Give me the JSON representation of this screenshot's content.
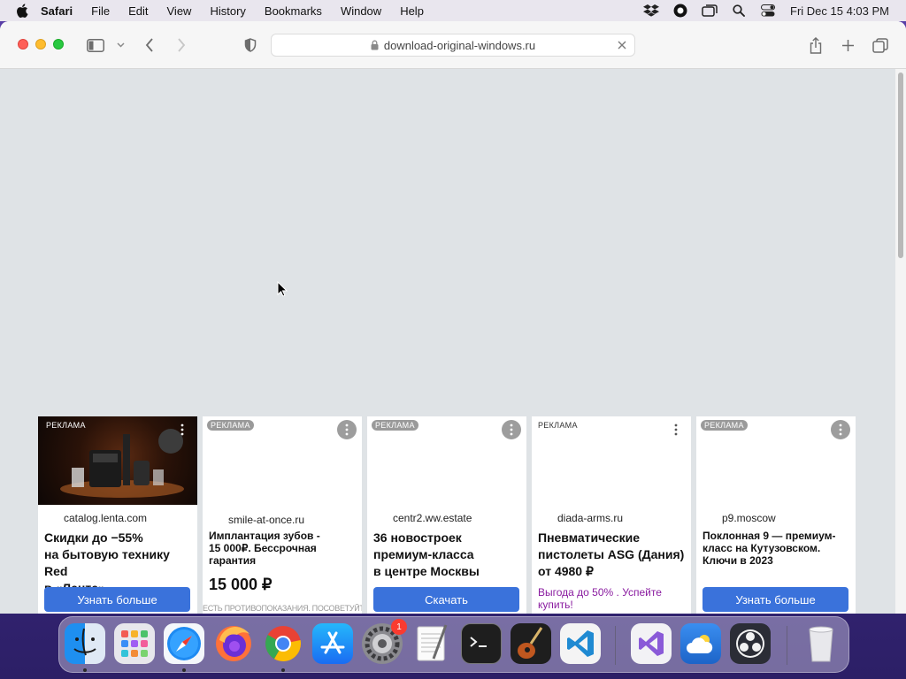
{
  "menubar": {
    "app": "Safari",
    "items": [
      "File",
      "Edit",
      "View",
      "History",
      "Bookmarks",
      "Window",
      "Help"
    ],
    "clock": "Fri Dec 15  4:03 PM",
    "status_icons": [
      "dropbox-icon",
      "record-icon",
      "screens-icon",
      "spotlight-icon",
      "control-center-icon"
    ]
  },
  "browser": {
    "url": "download-original-windows.ru"
  },
  "ads": [
    {
      "badge": "РЕКЛАМА",
      "domain": "catalog.lenta.com",
      "title_lines": [
        "Скидки до −55%",
        "на бытовую технику Red",
        "в «Ленте»"
      ],
      "cta": "Узнать больше"
    },
    {
      "badge": "РЕКЛАМА",
      "domain": "smile-at-once.ru",
      "title_lines": [
        "Имплантация зубов -",
        "15 000₽. Бессрочная",
        "гарантия"
      ],
      "price": "15 000 ₽",
      "disclaimer": "ЕСТЬ ПРОТИВОПОКАЗАНИЯ. ПОСОВЕТУЙТЕСЬ С ВРАЧОМ"
    },
    {
      "badge": "РЕКЛАМА",
      "domain": "centr2.ww.estate",
      "title_lines": [
        "36 новостроек",
        "премиум-класса",
        "в центре Москвы"
      ],
      "cta": "Скачать"
    },
    {
      "badge": "РЕКЛАМА",
      "domain": "diada-arms.ru",
      "title_lines": [
        "Пневматические",
        "пистолеты ASG (Дания)",
        "от 4980 ₽"
      ],
      "promo": "Выгода до 50% . Успейте купить!"
    },
    {
      "badge": "РЕКЛАМА",
      "domain": "p9.moscow",
      "title_lines": [
        "Поклонная 9 — премиум-",
        "класс на Кутузовском.",
        "Ключи в 2023"
      ],
      "cta": "Узнать больше"
    }
  ],
  "dock": {
    "apps": [
      "Finder",
      "Launchpad",
      "Safari",
      "Firefox",
      "Chrome",
      "App Store",
      "System Preferences",
      "TextEdit",
      "Terminal",
      "GarageBand",
      "Visual Studio Code",
      "Visual Studio",
      "Weather",
      "OBS"
    ],
    "system_preferences_badge": "1"
  }
}
